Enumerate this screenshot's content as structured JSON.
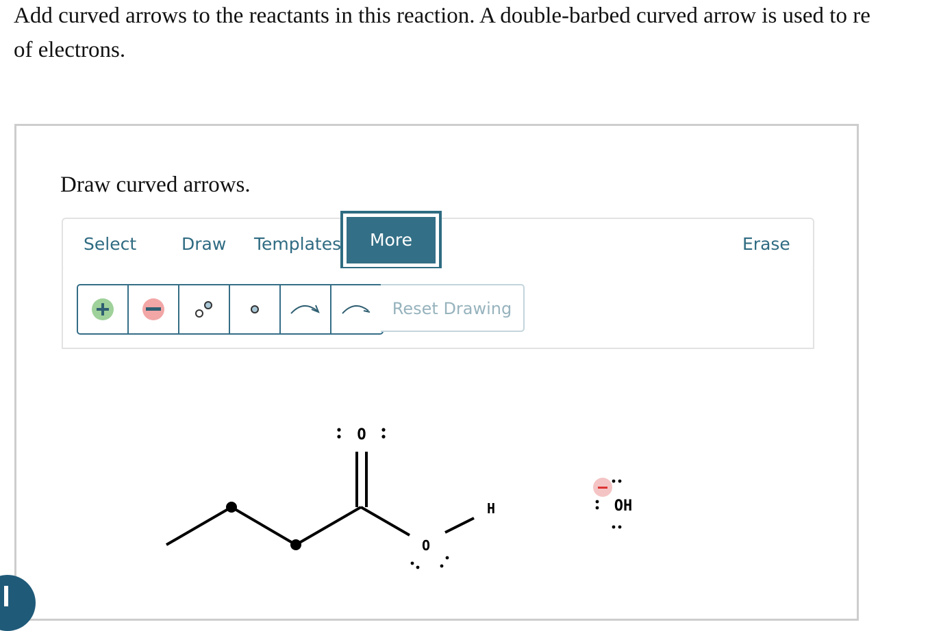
{
  "question": {
    "line1": "Add curved arrows to the reactants in this reaction. A double-barbed curved arrow is used to re",
    "line2": "of electrons."
  },
  "panel": {
    "title": "Draw curved arrows."
  },
  "tabs": {
    "select": "Select",
    "draw": "Draw",
    "templates": "Templates",
    "more": "More",
    "erase": "Erase"
  },
  "tools": {
    "reset_label": "Reset Drawing",
    "items": [
      "plus-charge-icon",
      "minus-charge-icon",
      "lone-pair-icon",
      "radical-electron-icon",
      "double-barb-arrow-icon",
      "single-barb-arrow-icon"
    ]
  },
  "molecule": {
    "carbonyl_oxygen": "O",
    "ester_oxygen": "O",
    "hydrogen": "H",
    "hydroxide": "OH"
  },
  "colors": {
    "accent": "#336f86",
    "positive": "#9fd19a",
    "negative": "#f2a6a6"
  }
}
